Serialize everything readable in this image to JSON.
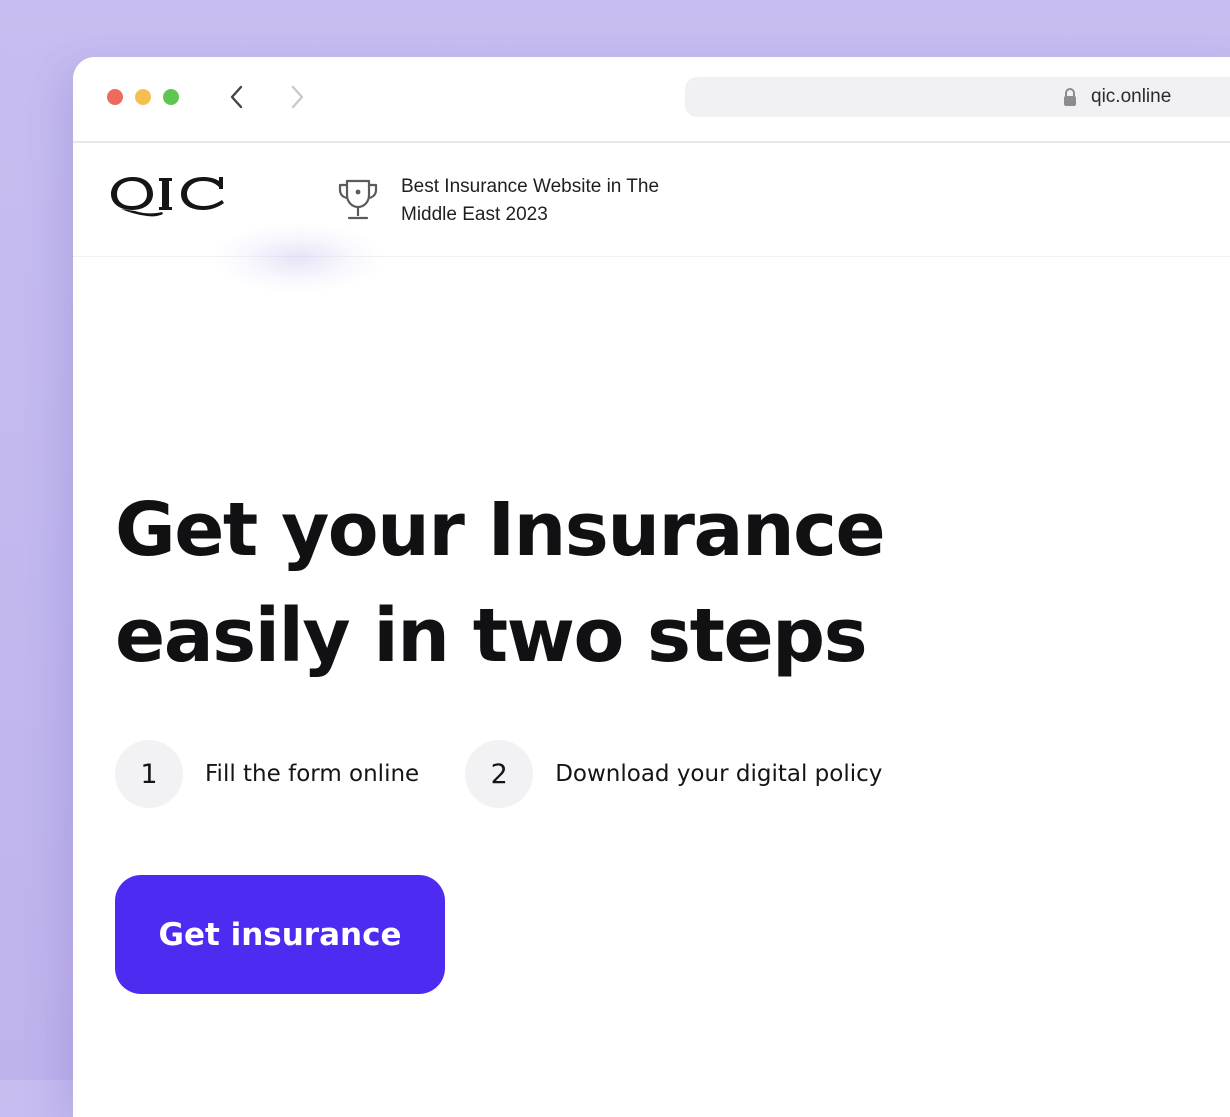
{
  "browser": {
    "url": "qic.online"
  },
  "header": {
    "award_line_1": "Best Insurance Website in The",
    "award_line_2": "Middle East 2023"
  },
  "hero": {
    "title_line_1": "Get your Insurance",
    "title_line_2": "easily in two steps",
    "steps": [
      {
        "number": "1",
        "label": "Fill the form online"
      },
      {
        "number": "2",
        "label": "Download your digital policy"
      }
    ],
    "cta_label": "Get insurance"
  },
  "colors": {
    "background": "#c5bbf0",
    "accent": "#4f2af0",
    "step_circle": "#f2f2f4",
    "text": "#111114"
  },
  "icons": [
    "chevron-left-icon",
    "chevron-right-icon",
    "lock-icon",
    "qic-logo",
    "trophy-icon"
  ]
}
